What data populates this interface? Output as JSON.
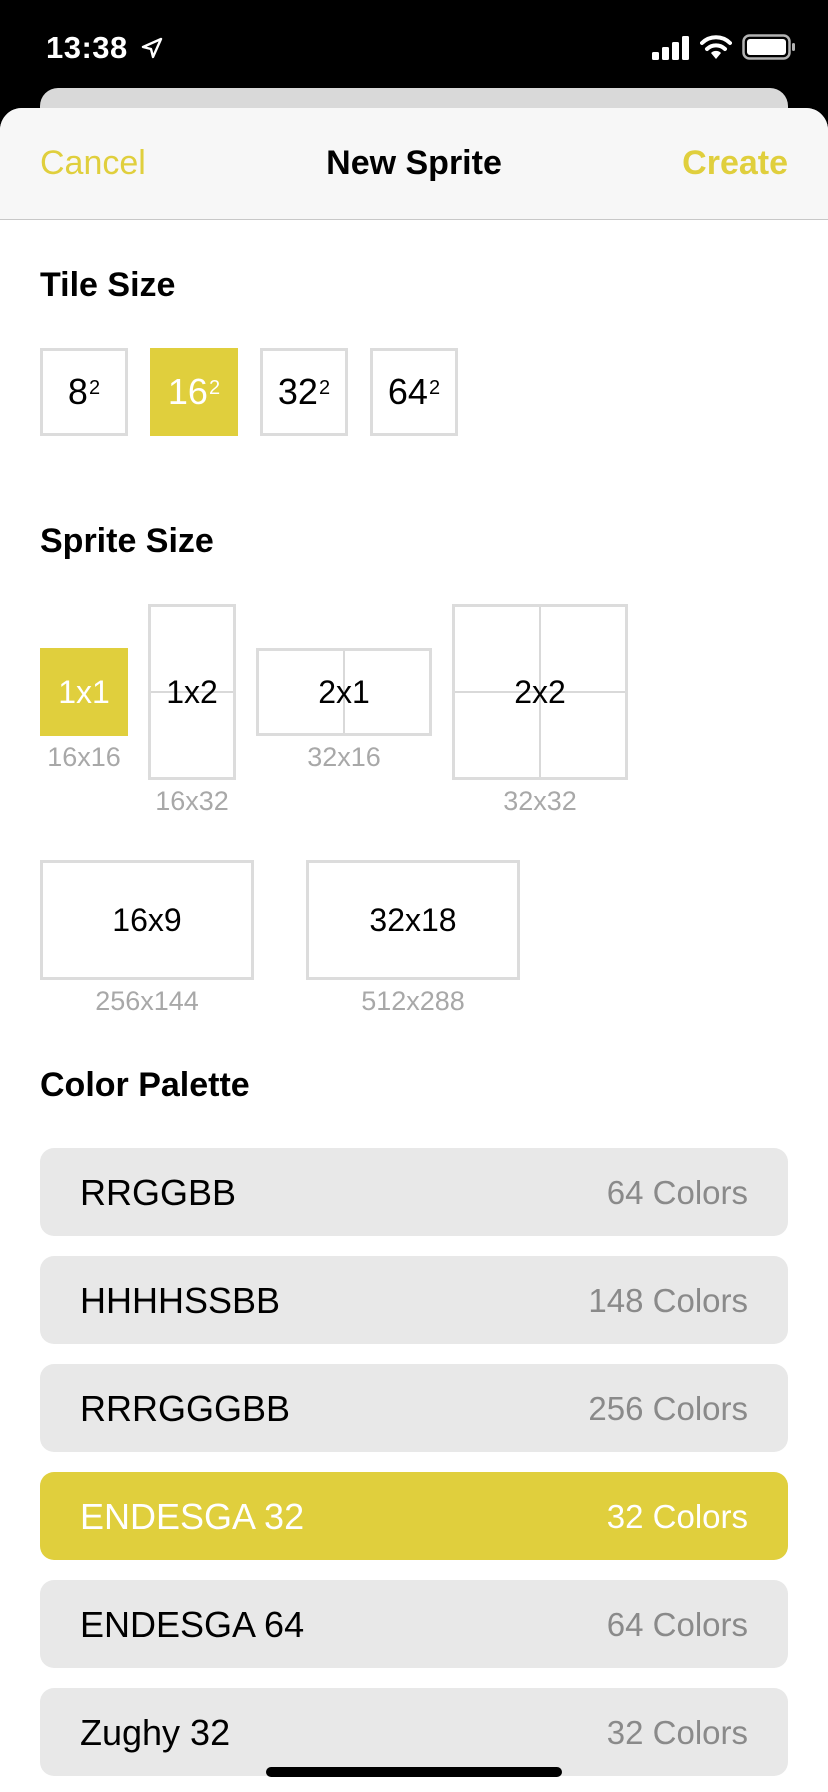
{
  "status_bar": {
    "time": "13:38"
  },
  "nav": {
    "cancel": "Cancel",
    "title": "New Sprite",
    "create": "Create"
  },
  "accent_color": "#e0cf3d",
  "tile_size": {
    "title": "Tile Size",
    "options": [
      {
        "base": "8",
        "exp": "2",
        "selected": false
      },
      {
        "base": "16",
        "exp": "2",
        "selected": true
      },
      {
        "base": "32",
        "exp": "2",
        "selected": false
      },
      {
        "base": "64",
        "exp": "2",
        "selected": false
      }
    ]
  },
  "sprite_size": {
    "title": "Sprite Size",
    "options": [
      {
        "label": "1x1",
        "pixels": "16x16",
        "selected": true
      },
      {
        "label": "1x2",
        "pixels": "16x32",
        "selected": false
      },
      {
        "label": "2x1",
        "pixels": "32x16",
        "selected": false
      },
      {
        "label": "2x2",
        "pixels": "32x32",
        "selected": false
      },
      {
        "label": "16x9",
        "pixels": "256x144",
        "selected": false
      },
      {
        "label": "32x18",
        "pixels": "512x288",
        "selected": false
      }
    ]
  },
  "color_palette": {
    "title": "Color Palette",
    "items": [
      {
        "name": "RRGGBB",
        "count": "64 Colors",
        "selected": false
      },
      {
        "name": "HHHHSSBB",
        "count": "148 Colors",
        "selected": false
      },
      {
        "name": "RRRGGGBB",
        "count": "256 Colors",
        "selected": false
      },
      {
        "name": "ENDESGA 32",
        "count": "32 Colors",
        "selected": true
      },
      {
        "name": "ENDESGA 64",
        "count": "64 Colors",
        "selected": false
      },
      {
        "name": "Zughy 32",
        "count": "32 Colors",
        "selected": false
      }
    ]
  }
}
